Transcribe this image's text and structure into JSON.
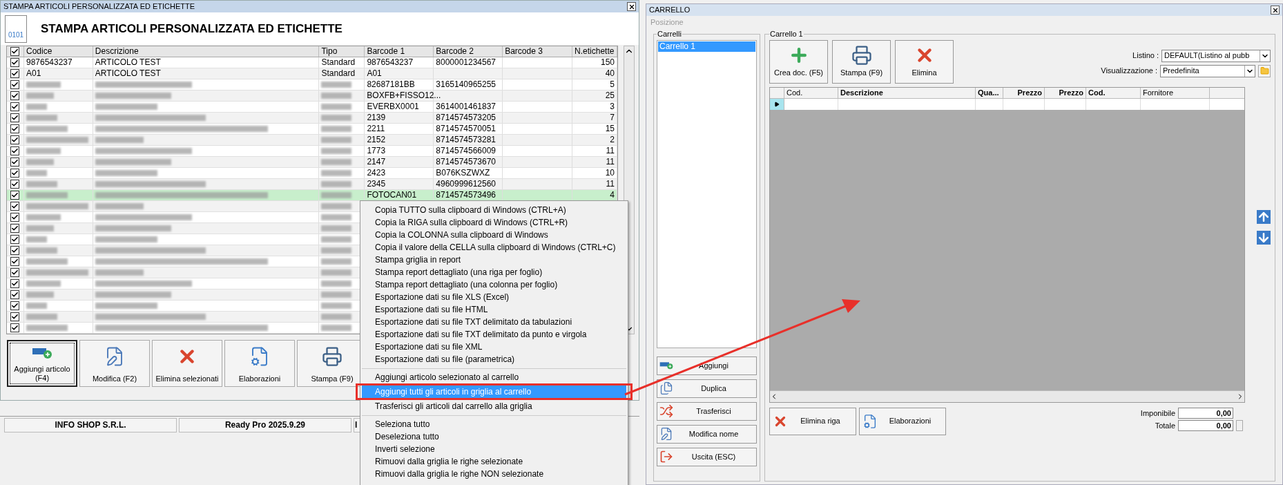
{
  "left_window": {
    "title": "STAMPA ARTICOLI PERSONALIZZATA ED ETICHETTE",
    "header": {
      "icon_text": "0101",
      "title": "STAMPA ARTICOLI PERSONALIZZATA ED ETICHETTE"
    },
    "grid": {
      "all_checked": true,
      "columns": [
        "Codice",
        "Descrizione",
        "Tipo",
        "Barcode 1",
        "Barcode 2",
        "Barcode 3",
        "N.etichette"
      ],
      "rows": [
        {
          "checked": true,
          "selected": false,
          "blurred": false,
          "codice": "9876543237",
          "descrizione": "ARTICOLO TEST",
          "tipo": "Standard",
          "barcode_1": "9876543237",
          "barcode_2": "8000001234567",
          "n_etichette": "150"
        },
        {
          "checked": true,
          "selected": false,
          "blurred": false,
          "codice": "A01",
          "descrizione": "ARTICOLO TEST",
          "tipo": "Standard",
          "barcode_1": "A01",
          "n_etichette": "40"
        },
        {
          "checked": true,
          "selected": false,
          "blurred": true,
          "barcode_1": "82687181BB",
          "barcode_2": "3165140965255",
          "n_etichette": "5"
        },
        {
          "checked": true,
          "selected": false,
          "blurred": true,
          "barcode_1": "BOXFB+FISSO12...",
          "n_etichette": "25"
        },
        {
          "checked": true,
          "selected": false,
          "blurred": true,
          "barcode_1": "EVERBX0001",
          "barcode_2": "3614001461837",
          "n_etichette": "3"
        },
        {
          "checked": true,
          "selected": false,
          "blurred": true,
          "barcode_1": "2139",
          "barcode_2": "8714574573205",
          "n_etichette": "7"
        },
        {
          "checked": true,
          "selected": false,
          "blurred": true,
          "barcode_1": "2211",
          "barcode_2": "8714574570051",
          "n_etichette": "15"
        },
        {
          "checked": true,
          "selected": false,
          "blurred": true,
          "barcode_1": "2152",
          "barcode_2": "8714574573281",
          "n_etichette": "2"
        },
        {
          "checked": true,
          "selected": false,
          "blurred": true,
          "barcode_1": "1773",
          "barcode_2": "8714574566009",
          "n_etichette": "11"
        },
        {
          "checked": true,
          "selected": false,
          "blurred": true,
          "barcode_1": "2147",
          "barcode_2": "8714574573670",
          "n_etichette": "11"
        },
        {
          "checked": true,
          "selected": false,
          "blurred": true,
          "barcode_1": "2423",
          "barcode_2": "B076KSZWXZ",
          "n_etichette": "10"
        },
        {
          "checked": true,
          "selected": false,
          "blurred": true,
          "barcode_1": "2345",
          "barcode_2": "4960999612560",
          "n_etichette": "11"
        },
        {
          "checked": true,
          "selected": true,
          "blurred": true,
          "barcode_1": "FOTOCAN01",
          "barcode_2": "8714574573496",
          "n_etichette": "4"
        },
        {
          "checked": true,
          "selected": false,
          "blurred": true
        },
        {
          "checked": true,
          "selected": false,
          "blurred": true
        },
        {
          "checked": true,
          "selected": false,
          "blurred": true
        },
        {
          "checked": true,
          "selected": false,
          "blurred": true
        },
        {
          "checked": true,
          "selected": false,
          "blurred": true
        },
        {
          "checked": true,
          "selected": false,
          "blurred": true
        },
        {
          "checked": true,
          "selected": false,
          "blurred": true
        },
        {
          "checked": true,
          "selected": false,
          "blurred": true
        },
        {
          "checked": true,
          "selected": false,
          "blurred": true
        },
        {
          "checked": true,
          "selected": false,
          "blurred": true
        },
        {
          "checked": true,
          "selected": false,
          "blurred": true
        },
        {
          "checked": true,
          "selected": false,
          "blurred": true
        }
      ]
    },
    "buttons": [
      {
        "label": "Aggiungi articolo (F4)",
        "focused": true
      },
      {
        "label": "Modifica (F2)",
        "focused": false
      },
      {
        "label": "Elimina selezionati",
        "focused": false
      },
      {
        "label": "Elaborazioni",
        "focused": false
      },
      {
        "label": "Stampa (F9)",
        "focused": false
      }
    ]
  },
  "status_bar": [
    "INFO SHOP S.R.L.",
    "Ready Pro 2025.9.29",
    "I"
  ],
  "context_menu": {
    "groups": [
      [
        {
          "label": "Copia TUTTO sulla clipboard di Windows (CTRL+A)",
          "selected": false
        },
        {
          "label": "Copia la RIGA sulla clipboard di Windows (CTRL+R)",
          "selected": false
        },
        {
          "label": "Copia la COLONNA sulla clipboard di Windows",
          "selected": false
        },
        {
          "label": "Copia il valore della CELLA sulla clipboard di Windows (CTRL+C)",
          "selected": false
        },
        {
          "label": "Stampa griglia in report",
          "selected": false
        },
        {
          "label": "Stampa report dettagliato (una riga per foglio)",
          "selected": false
        },
        {
          "label": "Stampa report dettagliato (una colonna per foglio)",
          "selected": false
        },
        {
          "label": "Esportazione dati su file XLS (Excel)",
          "selected": false
        },
        {
          "label": "Esportazione dati su file HTML",
          "selected": false
        },
        {
          "label": "Esportazione dati su file TXT delimitato da tabulazioni",
          "selected": false
        },
        {
          "label": "Esportazione dati su file TXT delimitato da punto e virgola",
          "selected": false
        },
        {
          "label": "Esportazione dati su file XML",
          "selected": false
        },
        {
          "label": "Esportazione dati su file (parametrica)",
          "selected": false
        }
      ],
      [
        {
          "label": "Aggiungi articolo selezionato al carrello",
          "selected": false
        },
        {
          "label": "Aggiungi tutti gli articoli in griglia al carrello",
          "selected": true
        },
        {
          "label": "Trasferisci gli articoli dal carrello alla griglia",
          "selected": false
        }
      ],
      [
        {
          "label": "Seleziona tutto",
          "selected": false
        },
        {
          "label": "Deseleziona tutto",
          "selected": false
        },
        {
          "label": "Inverti selezione",
          "selected": false
        },
        {
          "label": "Rimuovi dalla griglia le righe selezionate",
          "selected": false
        },
        {
          "label": "Rimuovi dalla griglia le righe NON selezionate",
          "selected": false
        }
      ]
    ]
  },
  "cart_window": {
    "title": "CARRELLO",
    "menu": [
      {
        "label": "Posizione",
        "disabled": true
      }
    ],
    "carts": {
      "label": "Carrelli",
      "items": [
        {
          "label": "Carrello 1",
          "selected": true
        }
      ],
      "buttons": [
        "Aggiungi",
        "Duplica",
        "Trasferisci",
        "Modifica nome",
        "Uscita (ESC)"
      ]
    },
    "cart": {
      "label": "Carrello 1",
      "toolbar": [
        "Crea doc. (F5)",
        "Stampa (F9)",
        "Elimina"
      ],
      "listino": {
        "label": "Listino :",
        "value": "DEFAULT(Listino al pubb"
      },
      "visualizzazione": {
        "label": "Visualizzazione :",
        "value": "Predefinita"
      },
      "columns": [
        {
          "label": "Cod.",
          "kind": "text"
        },
        {
          "label": "Descrizione",
          "kind": "bold"
        },
        {
          "label": "Qua...",
          "kind": "bold"
        },
        {
          "label": "Prezzo",
          "kind": "number"
        },
        {
          "label": "Prezzo",
          "kind": "number"
        },
        {
          "label": "Cod.",
          "kind": "bold"
        },
        {
          "label": "Fornitore",
          "kind": "text"
        }
      ],
      "bottom_buttons": [
        "Elimina riga",
        "Elaborazioni"
      ],
      "totals": [
        {
          "label": "Imponibile",
          "value": "0,00"
        },
        {
          "label": "Totale",
          "value": "0,00"
        }
      ]
    }
  }
}
